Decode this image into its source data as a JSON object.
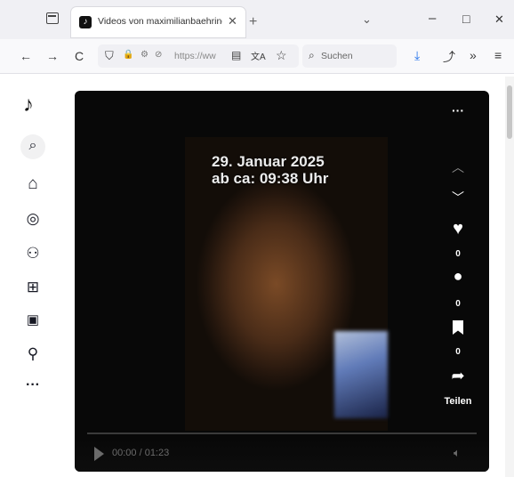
{
  "browser": {
    "tab_title": "Videos von maximilianbaehring",
    "new_tab": "+",
    "list_tabs": "⌄",
    "url": "https://ww",
    "search_placeholder": "Suchen",
    "win_min": "–",
    "win_max": "□",
    "win_close": "✕"
  },
  "toolbar_icons": {
    "back": "←",
    "forward": "→",
    "reload": "C",
    "shield": "⛉",
    "lock": "🔒",
    "translate": "文A",
    "bookmark": "☆",
    "download": "⤓",
    "extensions": "⤴",
    "more_tools": "»",
    "menu": "≡"
  },
  "sidebar": {
    "logo": "♪",
    "items": [
      {
        "icon": "search-icon",
        "glyph": "⌕"
      },
      {
        "icon": "home-icon",
        "glyph": "⌂"
      },
      {
        "icon": "explore-icon",
        "glyph": "◎"
      },
      {
        "icon": "following-icon",
        "glyph": "⚇"
      },
      {
        "icon": "upload-icon",
        "glyph": "⊞"
      },
      {
        "icon": "live-icon",
        "glyph": "▣"
      },
      {
        "icon": "profile-icon",
        "glyph": "⚲"
      },
      {
        "icon": "more-icon",
        "glyph": "···"
      }
    ]
  },
  "video": {
    "overlay_line1": "29. Januar 2025",
    "overlay_line2": "ab ca: 09:38 Uhr",
    "time": "00:00 / 01:23",
    "more": "···",
    "likes": "0",
    "comments": "0",
    "saves": "0",
    "share_label": "Teilen"
  }
}
